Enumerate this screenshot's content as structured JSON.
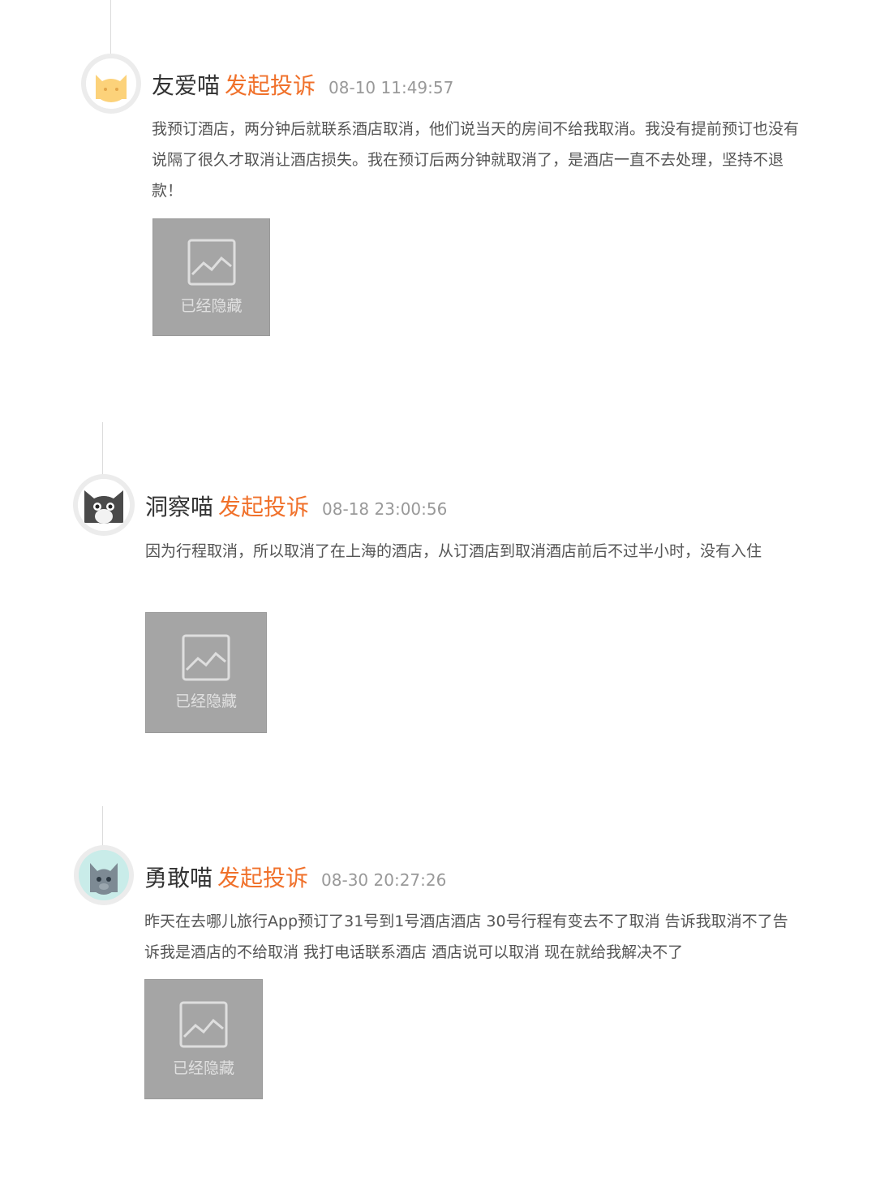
{
  "entries": [
    {
      "username": "友爱喵",
      "action": "发起投诉",
      "timestamp": "08-10 11:49:57",
      "content": "我预订酒店，两分钟后就联系酒店取消，他们说当天的房间不给我取消。我没有提前预订也没有说隔了很久才取消让酒店损失。我在预订后两分钟就取消了，是酒店一直不去处理，坚持不退款！",
      "avatar_icon": "orange-cat-icon",
      "image_label": "已经隐藏"
    },
    {
      "username": "洞察喵",
      "action": "发起投诉",
      "timestamp": "08-18 23:00:56",
      "content": "因为行程取消，所以取消了在上海的酒店，从订酒店到取消酒店前后不过半小时，没有入住",
      "avatar_icon": "dark-cat-icon",
      "image_label": "已经隐藏"
    },
    {
      "username": "勇敢喵",
      "action": "发起投诉",
      "timestamp": "08-30 20:27:26",
      "content": "昨天在去哪儿旅行App预订了31号到1号酒店酒店 30号行程有变去不了取消 告诉我取消不了告诉我是酒店的不给取消 我打电话联系酒店 酒店说可以取消 现在就给我解决不了",
      "avatar_icon": "gray-cat-icon",
      "image_label": "已经隐藏"
    }
  ],
  "colors": {
    "accent": "#f0712b",
    "timestamp": "#999999",
    "image_placeholder": "#a5a5a5"
  }
}
